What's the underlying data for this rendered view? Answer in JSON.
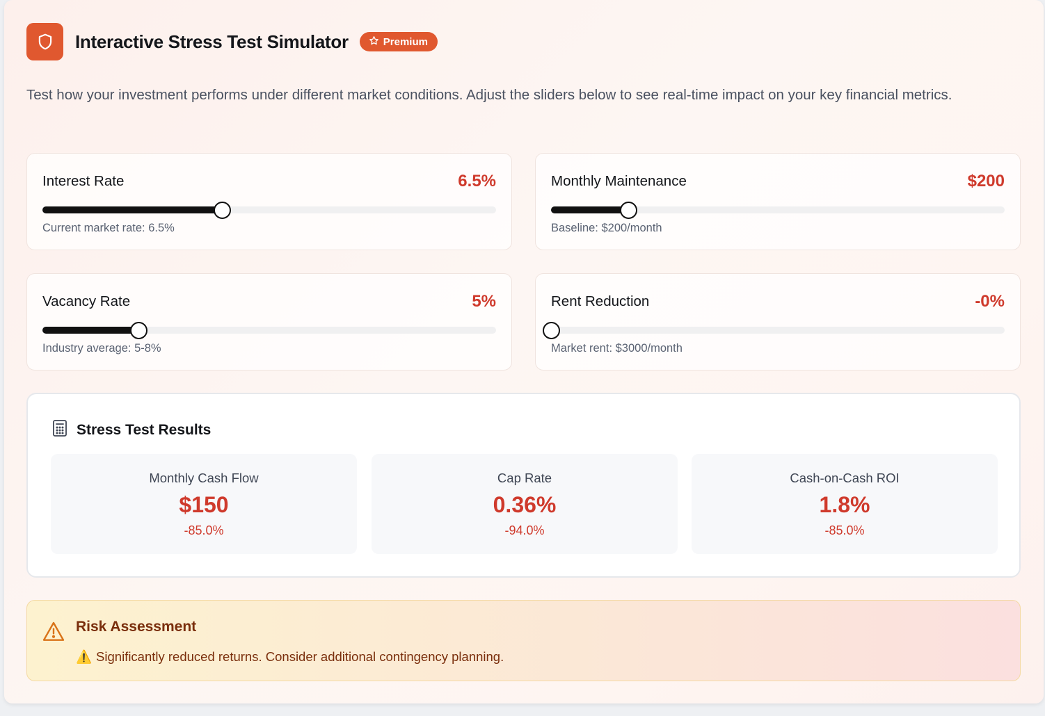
{
  "header": {
    "title": "Interactive Stress Test Simulator",
    "badge": "Premium",
    "logo_icon": "shield-icon",
    "badge_icon": "star-icon"
  },
  "description": "Test how your investment performs under different market conditions. Adjust the sliders below to see real-time impact on your key financial metrics.",
  "sliders": [
    {
      "label": "Interest Rate",
      "value": "6.5%",
      "hint": "Current market rate: 6.5%",
      "level_fraction": 0.395
    },
    {
      "label": "Monthly Maintenance",
      "value": "$200",
      "hint": "Baseline: $200/month",
      "level_fraction": 0.171
    },
    {
      "label": "Vacancy Rate",
      "value": "5%",
      "hint": "Industry average: 5-8%",
      "level_fraction": 0.212
    },
    {
      "label": "Rent Reduction",
      "value": "-0%",
      "hint": "Market rent: $3000/month",
      "level_fraction": 0.0
    }
  ],
  "results": {
    "title": "Stress Test Results",
    "icon": "calculator-icon",
    "metrics": [
      {
        "label": "Monthly Cash Flow",
        "value": "$150",
        "change": "-85.0%"
      },
      {
        "label": "Cap Rate",
        "value": "0.36%",
        "change": "-94.0%"
      },
      {
        "label": "Cash-on-Cash ROI",
        "value": "1.8%",
        "change": "-85.0%"
      }
    ]
  },
  "risk": {
    "title": "Risk Assessment",
    "icon": "warning-triangle-icon",
    "emoji": "⚠️",
    "message": "Significantly reduced returns. Consider additional contingency planning."
  },
  "colors": {
    "accent": "#e0582f",
    "negative": "#cf3a2c",
    "risk_text": "#7a2e0c",
    "slider_fill": "#111111"
  }
}
